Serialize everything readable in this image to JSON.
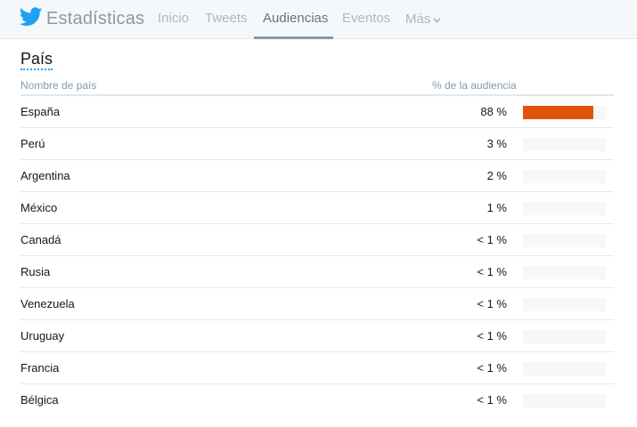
{
  "header": {
    "title": "Estadísticas",
    "logo": "twitter-bird-icon",
    "tabs": [
      {
        "label": "Inicio"
      },
      {
        "label": "Tweets"
      },
      {
        "label": "Audiencias",
        "active": true
      },
      {
        "label": "Eventos"
      },
      {
        "label": "Más"
      }
    ]
  },
  "section": {
    "title": "País"
  },
  "table": {
    "col_country": "Nombre de país",
    "col_pct": "% de la audiencia",
    "bar_color": "#e0540a",
    "track_color": "#f5f8fa",
    "rows": [
      {
        "country": "España",
        "pct": "88 %",
        "share": 0.85
      },
      {
        "country": "Perú",
        "pct": "3 %",
        "share": 0
      },
      {
        "country": "Argentina",
        "pct": "2 %",
        "share": 0
      },
      {
        "country": "México",
        "pct": "1 %",
        "share": 0
      },
      {
        "country": "Canadá",
        "pct": "< 1 %",
        "share": 0
      },
      {
        "country": "Rusia",
        "pct": "< 1 %",
        "share": 0
      },
      {
        "country": "Venezuela",
        "pct": "< 1 %",
        "share": 0
      },
      {
        "country": "Uruguay",
        "pct": "< 1 %",
        "share": 0
      },
      {
        "country": "Francia",
        "pct": "< 1 %",
        "share": 0
      },
      {
        "country": "Bélgica",
        "pct": "< 1 %",
        "share": 0
      }
    ]
  }
}
